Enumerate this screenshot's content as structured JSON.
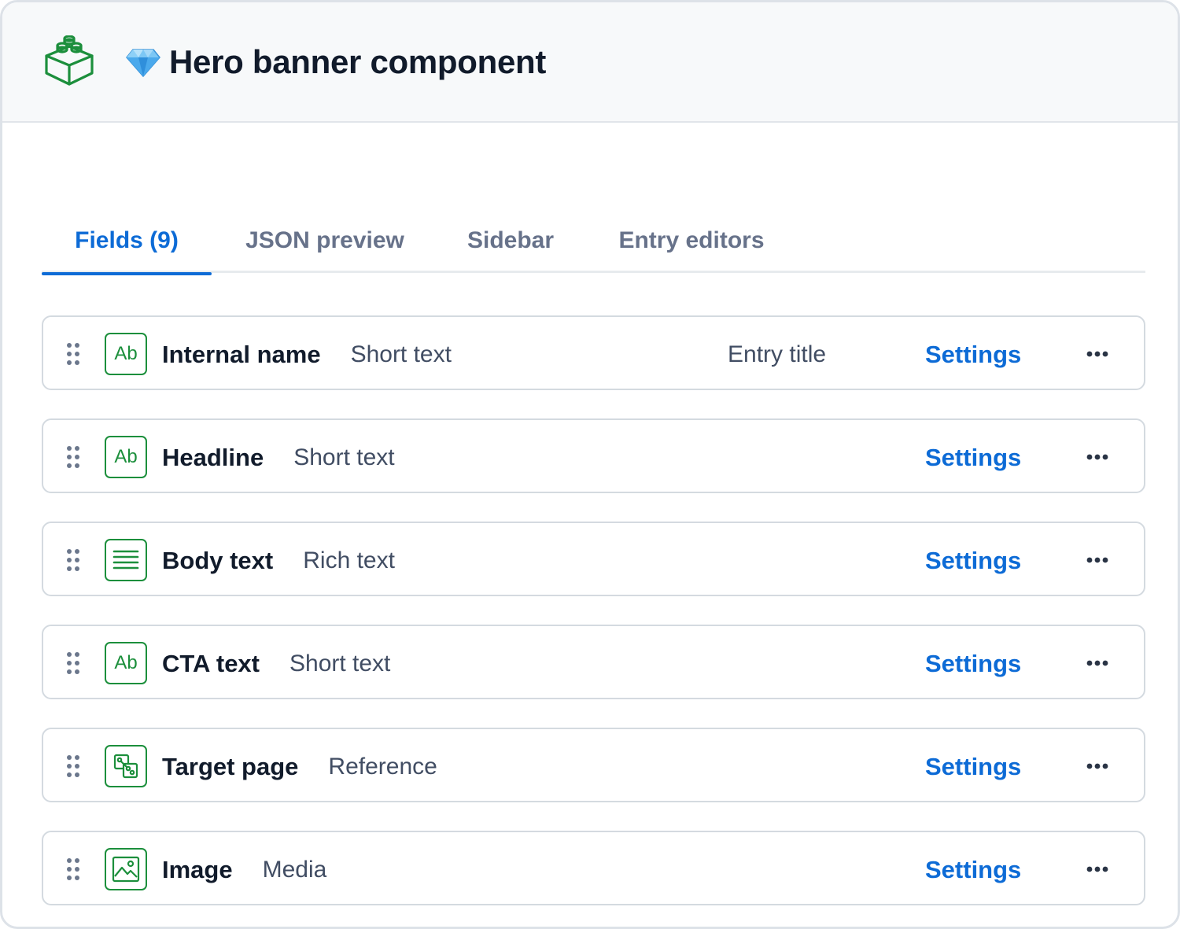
{
  "header": {
    "title": "Hero banner component",
    "icon": "content-type-blocks-icon",
    "emoji_icon": "gem-icon"
  },
  "tabs": [
    {
      "label": "Fields (9)",
      "active": true
    },
    {
      "label": "JSON preview",
      "active": false
    },
    {
      "label": "Sidebar",
      "active": false
    },
    {
      "label": "Entry editors",
      "active": false
    }
  ],
  "fields": [
    {
      "name": "Internal name",
      "type": "Short text",
      "type_icon": "text-ab-icon",
      "badge": "Entry title",
      "settings_label": "Settings"
    },
    {
      "name": "Headline",
      "type": "Short text",
      "type_icon": "text-ab-icon",
      "settings_label": "Settings"
    },
    {
      "name": "Body text",
      "type": "Rich text",
      "type_icon": "rich-text-lines-icon",
      "settings_label": "Settings"
    },
    {
      "name": "CTA text",
      "type": "Short text",
      "type_icon": "text-ab-icon",
      "settings_label": "Settings"
    },
    {
      "name": "Target page",
      "type": "Reference",
      "type_icon": "reference-icon",
      "settings_label": "Settings"
    },
    {
      "name": "Image",
      "type": "Media",
      "type_icon": "media-image-icon",
      "settings_label": "Settings"
    }
  ],
  "colors": {
    "accent": "#0d6bd6",
    "field_icon_green": "#1c8f3c",
    "header_bg": "#f7f9fa",
    "text_primary": "#111b2b",
    "text_secondary": "#414d63",
    "tab_inactive": "#67728a"
  }
}
